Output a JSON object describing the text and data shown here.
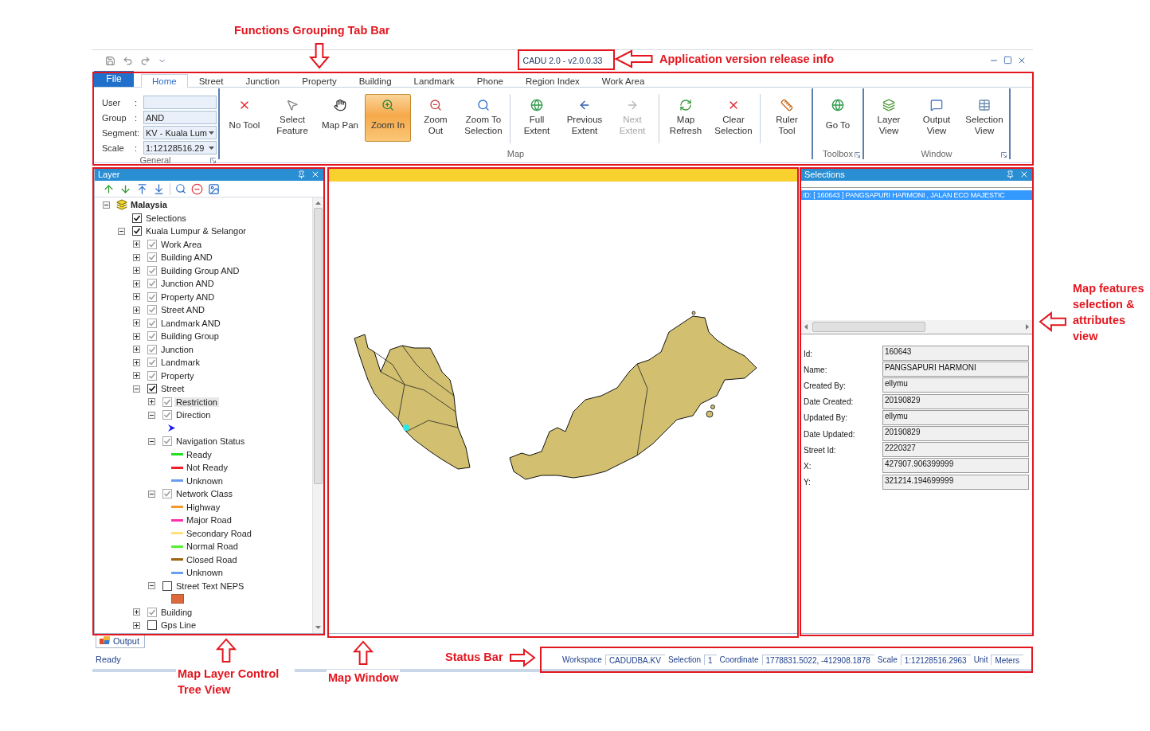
{
  "window": {
    "title": "CADU 2.0 - v2.0.0.33"
  },
  "ribbon_tabs": [
    {
      "label": "File",
      "kind": "file",
      "selected": false
    },
    {
      "label": "Home",
      "kind": "tab",
      "selected": true
    },
    {
      "label": "Street",
      "kind": "tab",
      "selected": false
    },
    {
      "label": "Junction",
      "kind": "tab",
      "selected": false
    },
    {
      "label": "Property",
      "kind": "tab",
      "selected": false
    },
    {
      "label": "Building",
      "kind": "tab",
      "selected": false
    },
    {
      "label": "Landmark",
      "kind": "tab",
      "selected": false
    },
    {
      "label": "Phone",
      "kind": "tab",
      "selected": false
    },
    {
      "label": "Region Index",
      "kind": "tab",
      "selected": false
    },
    {
      "label": "Work Area",
      "kind": "tab",
      "selected": false
    }
  ],
  "general": {
    "title": "General",
    "launcher": true,
    "fields": [
      {
        "label": "User",
        "separator": ":",
        "kind": "text"
      },
      {
        "label": "Group",
        "separator": ":",
        "kind": "text",
        "value": "AND"
      },
      {
        "label": "Segment:",
        "kind": "dropdown",
        "value": "KV - Kuala Lum"
      },
      {
        "label": "Scale",
        "separator": ":",
        "kind": "dropdown",
        "value": "1:12128516.29"
      }
    ]
  },
  "ribbon_groups": [
    {
      "title": "Map",
      "launcher": false,
      "sections": [
        [
          {
            "label": "No Tool",
            "selected": false,
            "disabled": false
          },
          {
            "label": "Select\nFeature",
            "selected": false,
            "disabled": false
          },
          {
            "label": "Map Pan",
            "selected": false,
            "disabled": false
          },
          {
            "label": "Zoom In",
            "selected": true,
            "disabled": false
          },
          {
            "label": "Zoom\nOut",
            "selected": false,
            "disabled": false
          },
          {
            "label": "Zoom To\nSelection",
            "selected": false,
            "disabled": false
          }
        ],
        [
          {
            "label": "Full\nExtent",
            "selected": false,
            "disabled": false
          },
          {
            "label": "Previous\nExtent",
            "selected": false,
            "disabled": false
          },
          {
            "label": "Next\nExtent",
            "selected": false,
            "disabled": true
          }
        ],
        [
          {
            "label": "Map\nRefresh",
            "selected": false,
            "disabled": false
          },
          {
            "label": "Clear\nSelection",
            "selected": false,
            "disabled": false
          }
        ],
        [
          {
            "label": "Ruler\nTool",
            "selected": false,
            "disabled": false
          }
        ]
      ]
    },
    {
      "title": "Toolbox",
      "launcher": true,
      "sections": [
        [
          {
            "label": "Go To",
            "selected": false,
            "disabled": false
          }
        ]
      ]
    },
    {
      "title": "Window",
      "launcher": true,
      "sections": [
        [
          {
            "label": "Layer\nView",
            "selected": false,
            "disabled": false
          },
          {
            "label": "Output\nView",
            "selected": false,
            "disabled": false
          },
          {
            "label": "Selection\nView",
            "selected": false,
            "disabled": false
          }
        ]
      ]
    }
  ],
  "layer_panel": {
    "title": "Layer",
    "tree": [
      {
        "kind": "root",
        "label": "Malaysia",
        "expanded": true,
        "children": [
          {
            "kind": "layer",
            "label": "Selections",
            "checked": true,
            "dimmed": false,
            "selected": false
          },
          {
            "kind": "layer",
            "label": "Kuala Lumpur & Selangor",
            "checked": true,
            "dimmed": false,
            "selected": false,
            "expanded": true,
            "children": [
              {
                "kind": "layer",
                "label": "Work Area",
                "checked": true,
                "dimmed": true,
                "selected": false,
                "expanded": false
              },
              {
                "kind": "layer",
                "label": "Building AND",
                "checked": true,
                "dimmed": true,
                "selected": false,
                "expanded": false
              },
              {
                "kind": "layer",
                "label": "Building Group AND",
                "checked": true,
                "dimmed": true,
                "selected": false,
                "expanded": false
              },
              {
                "kind": "layer",
                "label": "Junction AND",
                "checked": true,
                "dimmed": true,
                "selected": false,
                "expanded": false
              },
              {
                "kind": "layer",
                "label": "Property AND",
                "checked": true,
                "dimmed": true,
                "selected": false,
                "expanded": false
              },
              {
                "kind": "layer",
                "label": "Street AND",
                "checked": true,
                "dimmed": true,
                "selected": false,
                "expanded": false
              },
              {
                "kind": "layer",
                "label": "Landmark AND",
                "checked": true,
                "dimmed": true,
                "selected": false,
                "expanded": false
              },
              {
                "kind": "layer",
                "label": "Building Group",
                "checked": true,
                "dimmed": true,
                "selected": false,
                "expanded": false
              },
              {
                "kind": "layer",
                "label": "Junction",
                "checked": true,
                "dimmed": true,
                "selected": false,
                "expanded": false
              },
              {
                "kind": "layer",
                "label": "Landmark",
                "checked": true,
                "dimmed": true,
                "selected": false,
                "expanded": false
              },
              {
                "kind": "layer",
                "label": "Property",
                "checked": true,
                "dimmed": true,
                "selected": false,
                "expanded": false
              },
              {
                "kind": "layer",
                "label": "Street",
                "checked": true,
                "dimmed": false,
                "selected": false,
                "expanded": true,
                "children": [
                  {
                    "kind": "layer",
                    "label": "Restriction",
                    "checked": true,
                    "dimmed": true,
                    "selected": true,
                    "expanded": false
                  },
                  {
                    "kind": "layer",
                    "label": "Direction",
                    "checked": true,
                    "dimmed": true,
                    "selected": false,
                    "expanded": true,
                    "children": [
                      {
                        "kind": "arrow"
                      }
                    ]
                  },
                  {
                    "kind": "layer",
                    "label": "Navigation Status",
                    "checked": true,
                    "dimmed": true,
                    "selected": false,
                    "expanded": true,
                    "children": [
                      {
                        "kind": "legend",
                        "label": "Ready",
                        "color": "#22e022"
                      },
                      {
                        "kind": "legend",
                        "label": "Not Ready",
                        "color": "#ee1f2a"
                      },
                      {
                        "kind": "legend",
                        "label": "Unknown",
                        "color": "#6a9cf0"
                      }
                    ]
                  },
                  {
                    "kind": "layer",
                    "label": "Network Class",
                    "checked": true,
                    "dimmed": true,
                    "selected": false,
                    "expanded": true,
                    "children": [
                      {
                        "kind": "legend",
                        "label": "Highway",
                        "color": "#f7962a"
                      },
                      {
                        "kind": "legend",
                        "label": "Major Road",
                        "color": "#ff30b0"
                      },
                      {
                        "kind": "legend",
                        "label": "Secondary Road",
                        "color": "#ffe07a"
                      },
                      {
                        "kind": "legend",
                        "label": "Normal Road",
                        "color": "#55ee33"
                      },
                      {
                        "kind": "legend",
                        "label": "Closed Road",
                        "color": "#9a6410"
                      },
                      {
                        "kind": "legend",
                        "label": "Unknown",
                        "color": "#6a9cf0"
                      }
                    ]
                  },
                  {
                    "kind": "layer",
                    "label": "Street Text NEPS",
                    "checked": false,
                    "dimmed": false,
                    "selected": false,
                    "expanded": true,
                    "children": [
                      {
                        "kind": "swatch",
                        "color": "#dd6a3c"
                      }
                    ]
                  }
                ]
              },
              {
                "kind": "layer",
                "label": "Building",
                "checked": true,
                "dimmed": true,
                "selected": false,
                "expanded": false
              },
              {
                "kind": "layer",
                "label": "Gps Line",
                "checked": false,
                "dimmed": false,
                "selected": false,
                "expanded": false
              }
            ]
          }
        ]
      }
    ]
  },
  "selections_panel": {
    "title": "Selections",
    "items": [
      {
        "text": "ID: [ 160643 ] PANGSAPURI HARMONI , JALAN ECO MAJESTIC",
        "selected": true
      }
    ],
    "attributes": [
      {
        "label": "Id:",
        "value": "160643"
      },
      {
        "label": "Name:",
        "value": "PANGSAPURI HARMONI"
      },
      {
        "label": "Created By:",
        "value": "ellymu"
      },
      {
        "label": "Date Created:",
        "value": "20190829"
      },
      {
        "label": "Updated By:",
        "value": "ellymu"
      },
      {
        "label": "Date Updated:",
        "value": "20190829"
      },
      {
        "label": "Street Id:",
        "value": "2220327"
      },
      {
        "label": "X:",
        "value": "427907.906399999"
      },
      {
        "label": "Y:",
        "value": "321214.194699999"
      }
    ]
  },
  "output_tab": {
    "label": "Output"
  },
  "status_bar": {
    "text": "Ready",
    "fields": [
      {
        "label": "Workspace",
        "value": "CADUDBA.KV"
      },
      {
        "label": "Selection",
        "value": "1"
      },
      {
        "label": "Coordinate",
        "value": "1778831.5022, -412908.1878"
      },
      {
        "label": "Scale",
        "value": "1:12128516.2963"
      },
      {
        "label": "Unit",
        "value": "Meters"
      }
    ]
  },
  "annotations": [
    {
      "text": "Functions Grouping Tab Bar",
      "kind": "down"
    },
    {
      "text": "Application version release info",
      "kind": "left"
    },
    {
      "text": "Map features selection & attributes view",
      "kind": "left"
    },
    {
      "text": "Map Layer Control Tree View",
      "kind": "up"
    },
    {
      "text": "Map Window",
      "kind": "up"
    },
    {
      "text": "Status Bar",
      "kind": "right"
    }
  ]
}
